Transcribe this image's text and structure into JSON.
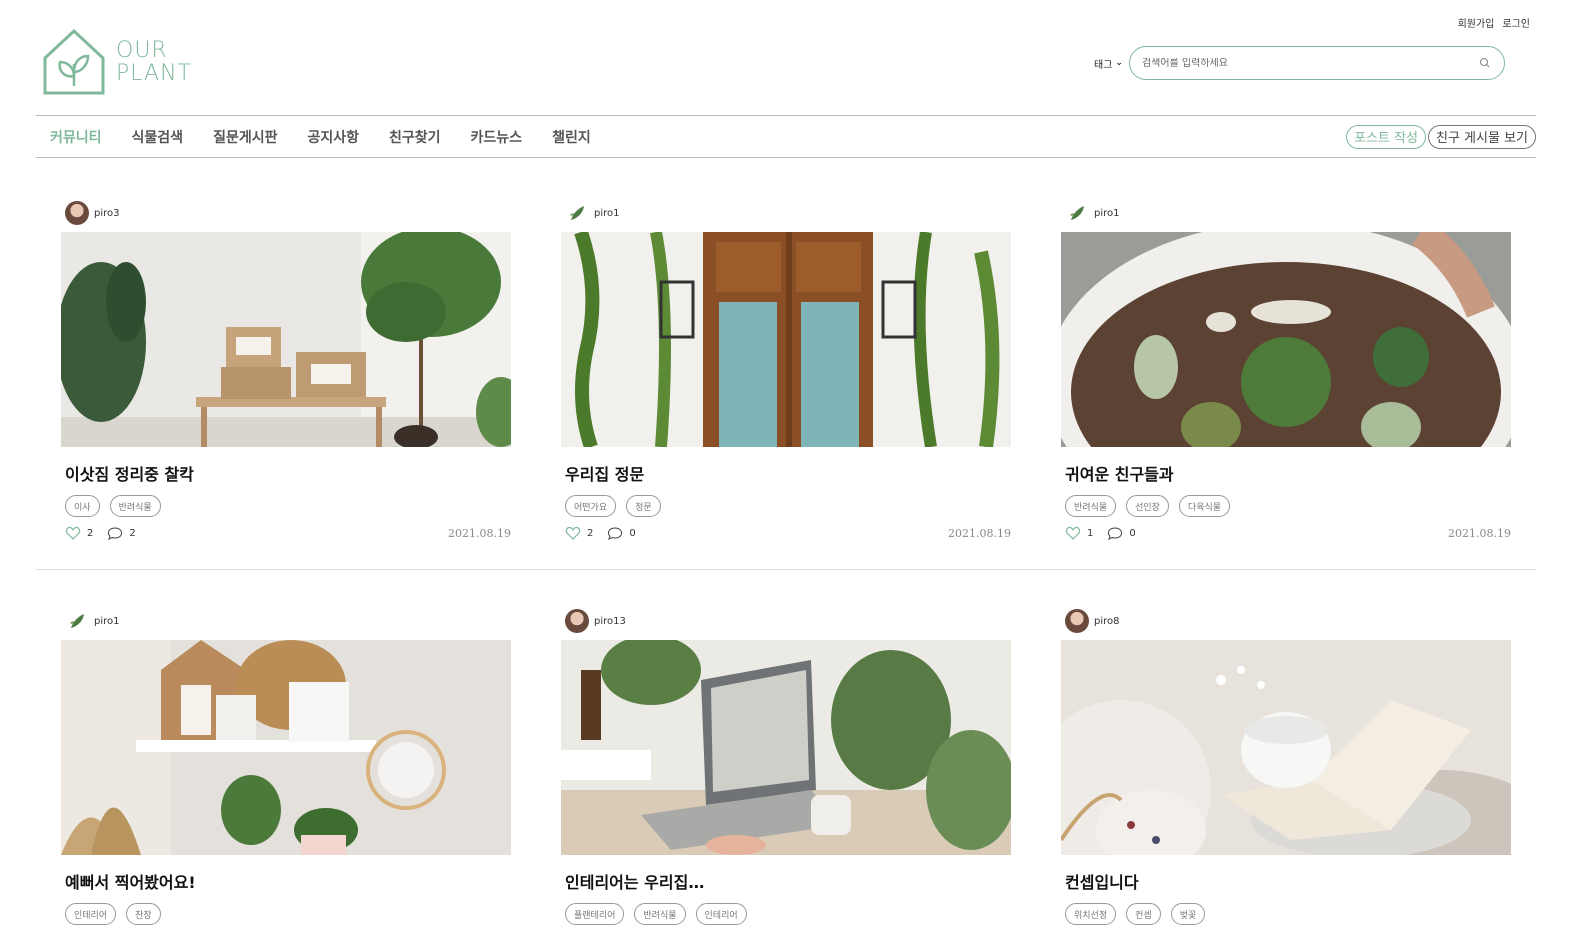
{
  "header": {
    "signup": "회원가입",
    "login": "로그인",
    "logo_line1": "OUR",
    "logo_line2": "PLANT",
    "tag_select": "태그",
    "search_placeholder": "검색어를 입력하세요"
  },
  "nav": {
    "items": [
      "커뮤니티",
      "식물검색",
      "질문게시판",
      "공지사항",
      "친구찾기",
      "카드뉴스",
      "챌린지"
    ],
    "active": "커뮤니티",
    "write_post": "포스트 작성",
    "friend_posts": "친구 게시물 보기"
  },
  "colors": {
    "accent": "#7fb89a"
  },
  "posts": [
    {
      "user": "piro3",
      "avatar": "photo",
      "image": "moving-boxes-plants",
      "title": "이삿짐 정리중 찰칵",
      "tags": [
        "이사",
        "반려식물"
      ],
      "likes": "2",
      "comments": "2",
      "date": "2021.08.19"
    },
    {
      "user": "piro1",
      "avatar": "leaf",
      "image": "wooden-door-ivy",
      "title": "우리집 정문",
      "tags": [
        "어떤가요",
        "정문"
      ],
      "likes": "2",
      "comments": "0",
      "date": "2021.08.19"
    },
    {
      "user": "piro1",
      "avatar": "leaf",
      "image": "cactus-bowl",
      "title": "귀여운 친구들과",
      "tags": [
        "반려식물",
        "선인장",
        "다육식물"
      ],
      "likes": "1",
      "comments": "0",
      "date": "2021.08.19"
    },
    {
      "user": "piro1",
      "avatar": "leaf",
      "image": "shelf-mirror",
      "title": "예뻐서 찍어봤어요!",
      "tags": [
        "인테리어",
        "찬장"
      ]
    },
    {
      "user": "piro13",
      "avatar": "photo",
      "image": "laptop-desk-plants",
      "title": "인테리어는 우리집…",
      "tags": [
        "플랜테리어",
        "반려식물",
        "인테리어"
      ]
    },
    {
      "user": "piro8",
      "avatar": "photo",
      "image": "book-teacup",
      "title": "컨셉입니다",
      "tags": [
        "위치선정",
        "컨셉",
        "벚꽃"
      ]
    }
  ]
}
